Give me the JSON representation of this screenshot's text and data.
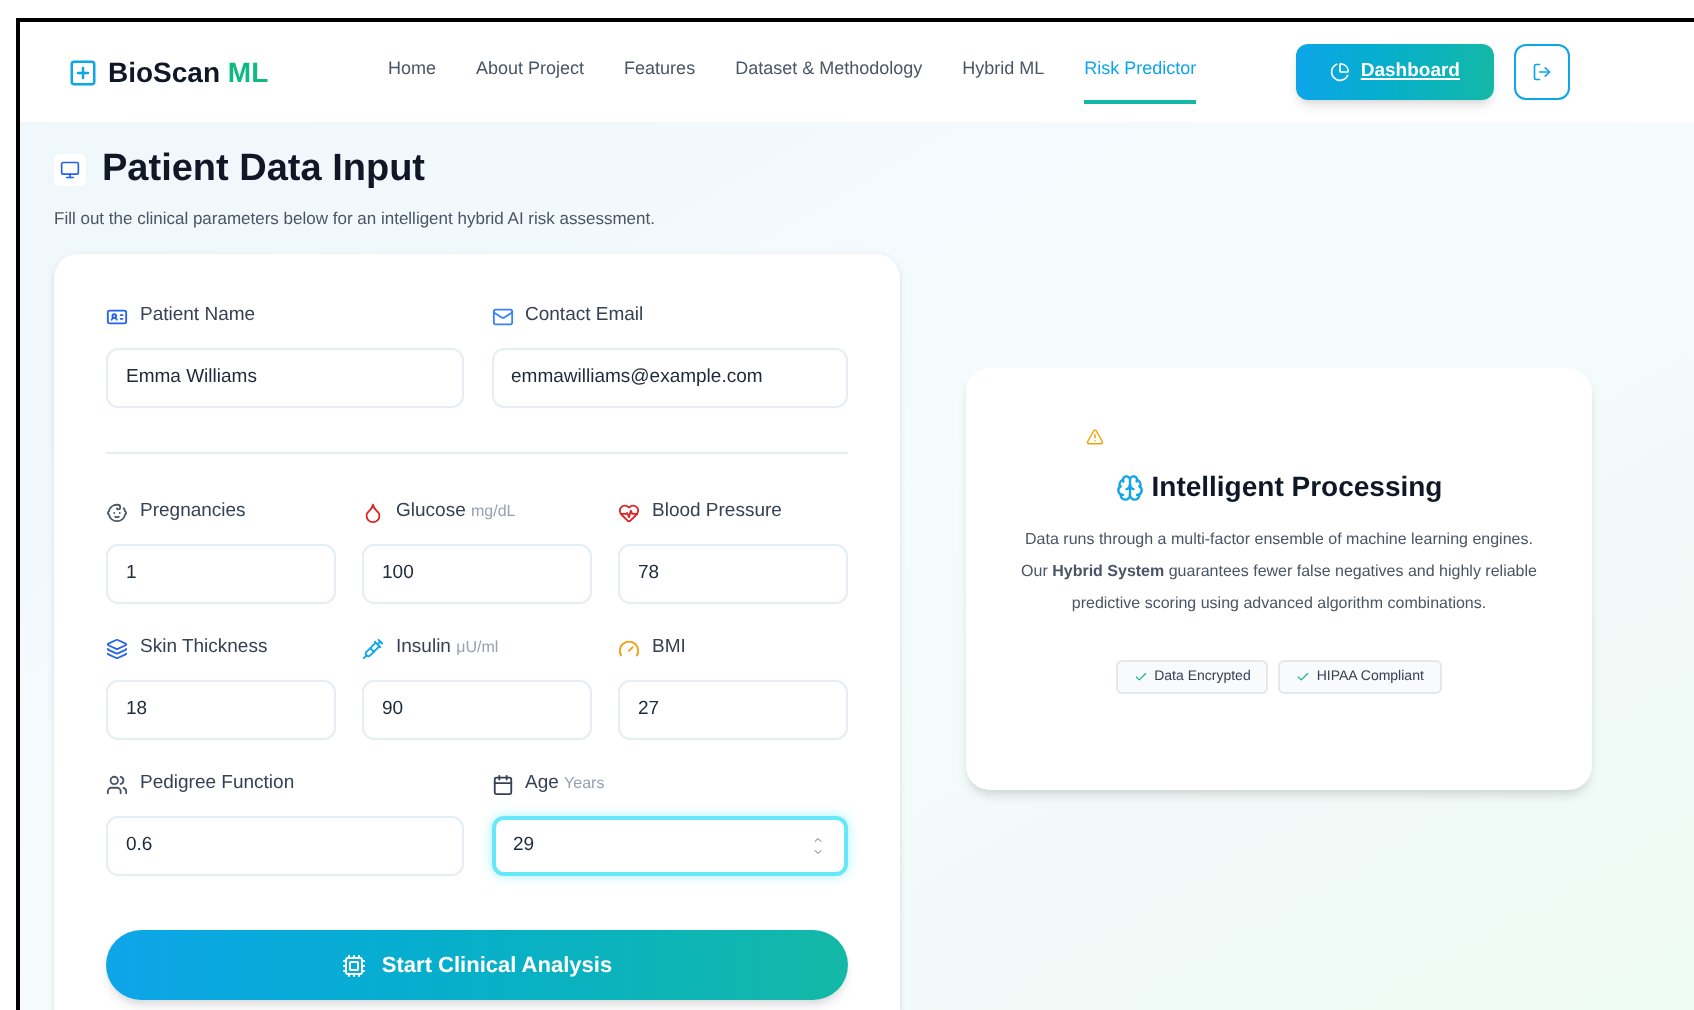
{
  "brand": {
    "name": "BioScan",
    "suffix": "ML"
  },
  "nav": [
    {
      "label": "Home",
      "selected": false
    },
    {
      "label": "About Project",
      "selected": false
    },
    {
      "label": "Features",
      "selected": false
    },
    {
      "label": "Dataset & Methodology",
      "selected": false
    },
    {
      "label": "Hybrid ML",
      "selected": false
    },
    {
      "label": "Risk Predictor",
      "selected": true
    }
  ],
  "dashboard_button": "Dashboard",
  "page": {
    "title": "Patient Data Input",
    "subtitle": "Fill out the clinical parameters below for an intelligent hybrid AI risk assessment."
  },
  "contact_fields": [
    {
      "label": "Patient Name",
      "value": "Emma Williams",
      "focused": false
    },
    {
      "label": "Contact Email",
      "value": "emmawilliams@example.com",
      "focused": false
    }
  ],
  "clinical_fields": [
    {
      "label": "Pregnancies",
      "value": "1",
      "focused": false
    },
    {
      "label": "Glucose",
      "unit": "mg/dL",
      "value": "100",
      "focused": false
    },
    {
      "label": "Blood Pressure",
      "value": "78",
      "focused": false
    },
    {
      "label": "Skin Thickness",
      "value": "18",
      "focused": false
    },
    {
      "label": "Insulin",
      "unit": "μU/ml",
      "value": "90",
      "focused": false
    },
    {
      "label": "BMI",
      "value": "27",
      "focused": false
    }
  ],
  "extra_fields": [
    {
      "label": "Pedigree Function",
      "value": "0.6",
      "focused": false
    },
    {
      "label": "Age",
      "unit": "Years",
      "value": "29",
      "focused": true
    }
  ],
  "submit_button": "Start Clinical Analysis",
  "info_card": {
    "title": "Intelligent Processing",
    "text": "Data runs through a multi-factor ensemble of machine learning engines. Our **Hybrid System** guarantees fewer false negatives and highly reliable predictive scoring using advanced algorithm combinations.",
    "badges": [
      "Data Encrypted",
      "HIPAA Compliant"
    ]
  }
}
